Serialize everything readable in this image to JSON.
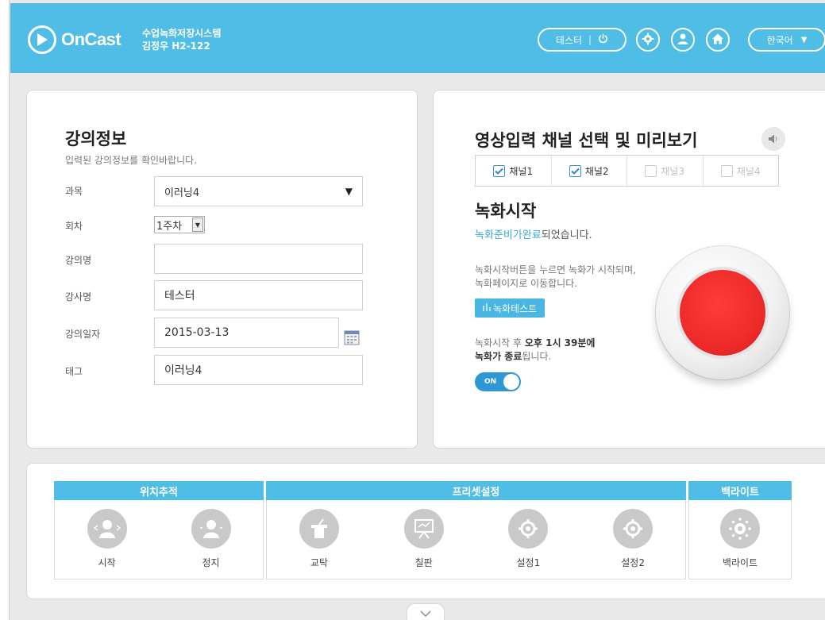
{
  "app": {
    "name": "OnCast",
    "system_name": "수업녹화저장시스템",
    "location": "김정우 H2-122"
  },
  "header": {
    "user_name": "테스터",
    "separator": "|",
    "language": "한국어"
  },
  "lecture_info": {
    "title": "강의정보",
    "subtitle": "입력된 강의정보를 확인바랍니다.",
    "fields": {
      "subject_label": "과목",
      "subject_value": "이러닝4",
      "session_label": "회차",
      "session_value": "1주차",
      "lecture_name_label": "강의명",
      "lecture_name_value": "",
      "instructor_label": "강사명",
      "instructor_value": "테스터",
      "date_label": "강의일자",
      "date_value": "2015-03-13",
      "tag_label": "태그",
      "tag_value": "이러닝4"
    }
  },
  "video": {
    "title": "영상입력 채널 선택 및 미리보기",
    "channels": [
      {
        "label": "채널1",
        "checked": true,
        "enabled": true
      },
      {
        "label": "채널2",
        "checked": true,
        "enabled": true
      },
      {
        "label": "채널3",
        "checked": false,
        "enabled": false
      },
      {
        "label": "채널4",
        "checked": false,
        "enabled": false
      }
    ],
    "record_title": "녹화시작",
    "status_highlight": "녹화준비가완료",
    "status_rest": "되었습니다.",
    "desc_line1": "녹화시작버튼을 누르면 녹화가 시작되며,",
    "desc_line2": "녹화페이지로 이동합니다.",
    "test_button": "녹화테스트",
    "end_pre": "녹화시작 후 ",
    "end_time": "오후 1시 39분에",
    "end_bold": "녹화가 종료",
    "end_post": "됩니다.",
    "toggle_label": "ON"
  },
  "controls": {
    "tracking": {
      "title": "위치추적",
      "items": [
        "시작",
        "정지"
      ]
    },
    "preset": {
      "title": "프리셋설정",
      "items": [
        "교탁",
        "칠판",
        "설정1",
        "설정2"
      ]
    },
    "backlight": {
      "title": "백라이트",
      "items": [
        "백라이트"
      ]
    }
  },
  "colors": {
    "accent": "#4fbde6",
    "record": "#ee2b2b",
    "toggle": "#2e98d6"
  }
}
